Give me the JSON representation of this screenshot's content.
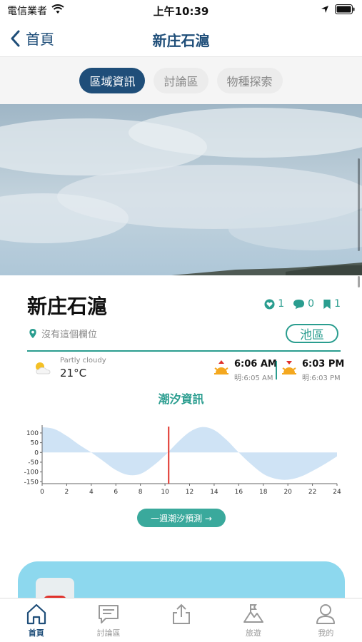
{
  "status": {
    "carrier": "電信業者",
    "time": "上午10:39"
  },
  "nav": {
    "back_label": "首頁",
    "title": "新庄石滬"
  },
  "tabs": [
    {
      "label": "區域資訊",
      "active": true
    },
    {
      "label": "討論區",
      "active": false
    },
    {
      "label": "物種探索",
      "active": false
    }
  ],
  "place": {
    "name": "新庄石滬",
    "likes": "1",
    "comments": "0",
    "bookmarks": "1",
    "location": "沒有這個欄位",
    "zone": "池區"
  },
  "weather": {
    "condition": "Partly cloudy",
    "temperature": "21°C"
  },
  "sun": {
    "sunrise": "6:06 AM",
    "sunrise_next": "明:6:05 AM",
    "sunset": "6:03 PM",
    "sunset_next": "明:6:03 PM"
  },
  "tide": {
    "title": "潮汐資訊",
    "week_button": "一週潮汐預測 →"
  },
  "chart_data": {
    "type": "area",
    "x": [
      0,
      1,
      2,
      3,
      4,
      5,
      6,
      7,
      8,
      9,
      10,
      11,
      12,
      13,
      14,
      15,
      16,
      17,
      18,
      19,
      20,
      21,
      22,
      23,
      24
    ],
    "values": [
      130,
      120,
      85,
      40,
      0,
      -45,
      -90,
      -115,
      -110,
      -70,
      -15,
      50,
      105,
      130,
      115,
      65,
      0,
      -60,
      -110,
      -135,
      -140,
      -125,
      -95,
      -60,
      -20
    ],
    "xticks": [
      0,
      2,
      4,
      6,
      8,
      10,
      12,
      14,
      16,
      18,
      20,
      22,
      24
    ],
    "yticks": [
      100,
      50,
      0,
      -50,
      -100,
      -150
    ],
    "xlim": [
      0,
      24
    ],
    "ylim": [
      -160,
      140
    ],
    "current_time": 10.3,
    "fill_color": "#cfe3f5",
    "marker_color": "#e0312a"
  },
  "tabbar": [
    {
      "label": "首頁",
      "icon": "home-icon",
      "active": true
    },
    {
      "label": "討論區",
      "icon": "chat-icon",
      "active": false
    },
    {
      "label": "",
      "icon": "share-icon",
      "active": false
    },
    {
      "label": "旅遊",
      "icon": "travel-icon",
      "active": false
    },
    {
      "label": "我的",
      "icon": "profile-icon",
      "active": false
    }
  ],
  "colors": {
    "primary": "#1f4e79",
    "accent": "#2a9d8f",
    "card": "#8dd8ee"
  }
}
